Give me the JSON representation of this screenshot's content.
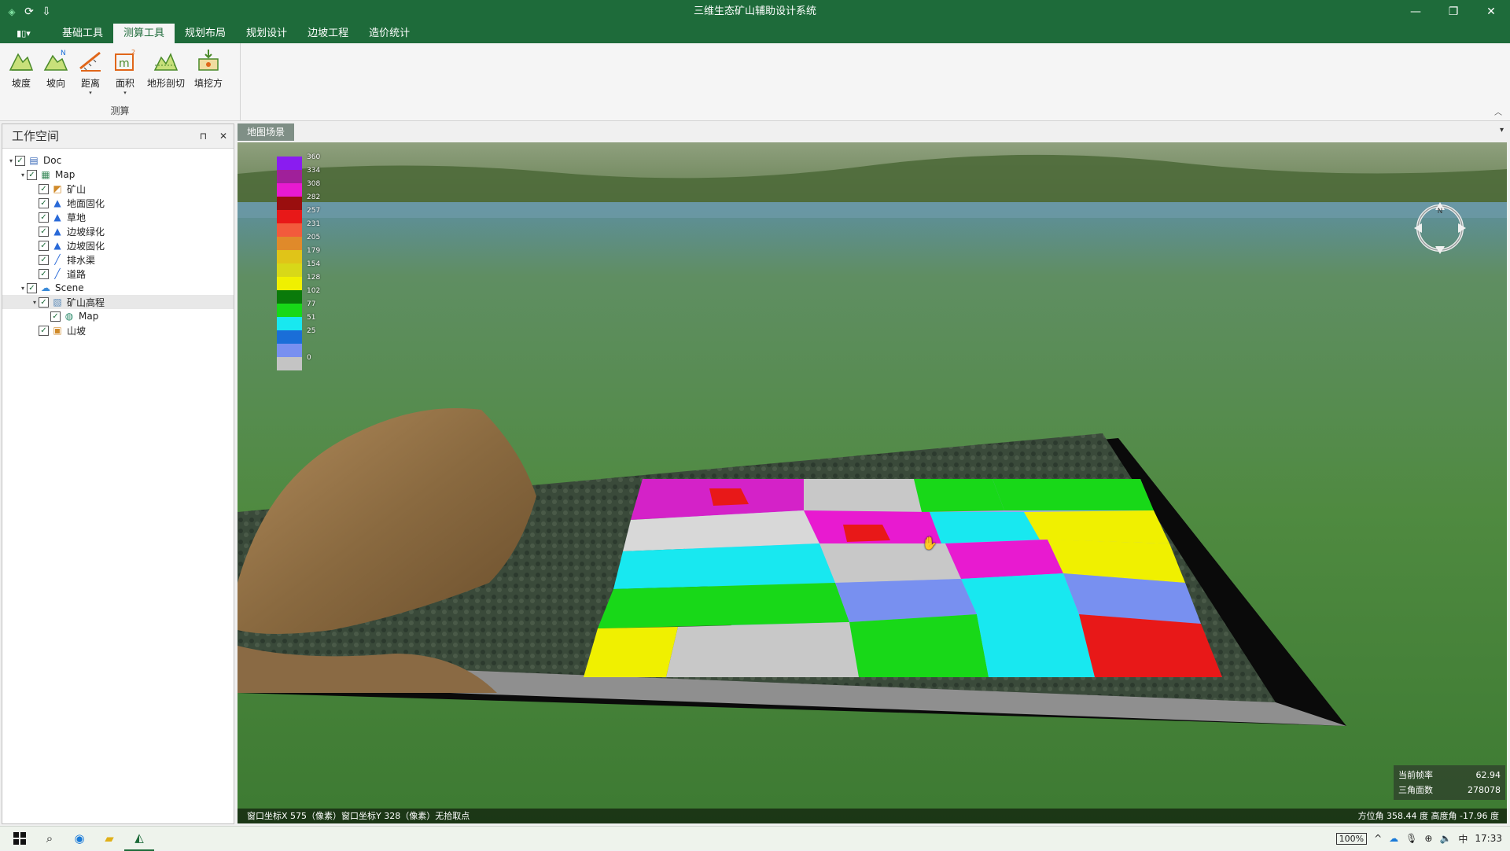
{
  "app": {
    "title": "三维生态矿山辅助设计系统",
    "quick_access": [
      "refresh-icon",
      "pin-icon"
    ]
  },
  "window_controls": {
    "minimize": "—",
    "restore": "❐",
    "close": "✕"
  },
  "ribbon": {
    "file_label": "▮▯▾",
    "tabs": [
      {
        "label": "基础工具",
        "active": false
      },
      {
        "label": "测算工具",
        "active": true
      },
      {
        "label": "规划布局",
        "active": false
      },
      {
        "label": "规划设计",
        "active": false
      },
      {
        "label": "边坡工程",
        "active": false
      },
      {
        "label": "造价统计",
        "active": false
      }
    ],
    "group_label": "测算",
    "tools": [
      {
        "label": "坡度",
        "icon": "slope-icon",
        "dropdown": false
      },
      {
        "label": "坡向",
        "icon": "aspect-icon",
        "dropdown": false
      },
      {
        "label": "距离",
        "icon": "distance-icon",
        "dropdown": true
      },
      {
        "label": "面积",
        "icon": "area-icon",
        "dropdown": true
      },
      {
        "label": "地形剖切",
        "icon": "terrain-profile-icon",
        "dropdown": false
      },
      {
        "label": "填挖方",
        "icon": "cut-fill-icon",
        "dropdown": false
      }
    ]
  },
  "workspace": {
    "title": "工作空间",
    "pin": "⊓",
    "close": "✕",
    "tree": [
      {
        "label": "Doc",
        "depth": 0,
        "expanded": true,
        "icon": "doc-icon"
      },
      {
        "label": "Map",
        "depth": 1,
        "expanded": true,
        "icon": "map-icon"
      },
      {
        "label": "矿山",
        "depth": 2,
        "icon": "mine-layer-icon"
      },
      {
        "label": "地面固化",
        "depth": 2,
        "icon": "region-layer-icon"
      },
      {
        "label": "草地",
        "depth": 2,
        "icon": "region-layer-icon"
      },
      {
        "label": "边坡绿化",
        "depth": 2,
        "icon": "region-layer-icon"
      },
      {
        "label": "边坡固化",
        "depth": 2,
        "icon": "region-layer-icon"
      },
      {
        "label": "排水渠",
        "depth": 2,
        "icon": "line-layer-icon"
      },
      {
        "label": "道路",
        "depth": 2,
        "icon": "line-layer-icon"
      },
      {
        "label": "Scene",
        "depth": 1,
        "expanded": true,
        "icon": "scene-icon"
      },
      {
        "label": "矿山高程",
        "depth": 2,
        "expanded": true,
        "icon": "elevation-icon",
        "selected": true
      },
      {
        "label": "Map",
        "depth": 3,
        "icon": "globe-icon"
      },
      {
        "label": "山坡",
        "depth": 2,
        "icon": "model-icon"
      }
    ]
  },
  "scene": {
    "tab_label": "地图场景",
    "legend": [
      {
        "value": "360",
        "color": "#8a1cf0"
      },
      {
        "value": "334",
        "color": "#a0209a"
      },
      {
        "value": "308",
        "color": "#e81ad0"
      },
      {
        "value": "282",
        "color": "#9a0e0e"
      },
      {
        "value": "257",
        "color": "#e81818"
      },
      {
        "value": "231",
        "color": "#f25a3c"
      },
      {
        "value": "205",
        "color": "#e08a2a"
      },
      {
        "value": "179",
        "color": "#e0c418"
      },
      {
        "value": "154",
        "color": "#d8d818"
      },
      {
        "value": "128",
        "color": "#f0f000"
      },
      {
        "value": "102",
        "color": "#0a7a0a"
      },
      {
        "value": "77",
        "color": "#18d818"
      },
      {
        "value": "51",
        "color": "#18e8f0"
      },
      {
        "value": "25",
        "color": "#1a6ed8"
      },
      {
        "value": "",
        "color": "#7890f0"
      },
      {
        "value": "0",
        "color": "#c4c4c4"
      }
    ],
    "compass_label": "N",
    "stats": {
      "fps_label": "当前帧率",
      "fps_value": "62.94",
      "tri_label": "三角面数",
      "tri_value": "278078"
    },
    "status_left": "窗口坐标X 575（像素）窗口坐标Y 328（像素）无拾取点",
    "status_right": "方位角    358.44  度    高度角    -17.96  度"
  },
  "taskbar": {
    "icons": [
      "start-icon",
      "search-icon",
      "edge-icon",
      "explorer-icon",
      "app-icon"
    ],
    "battery": "100%",
    "ime": "中",
    "time": "17:33"
  }
}
